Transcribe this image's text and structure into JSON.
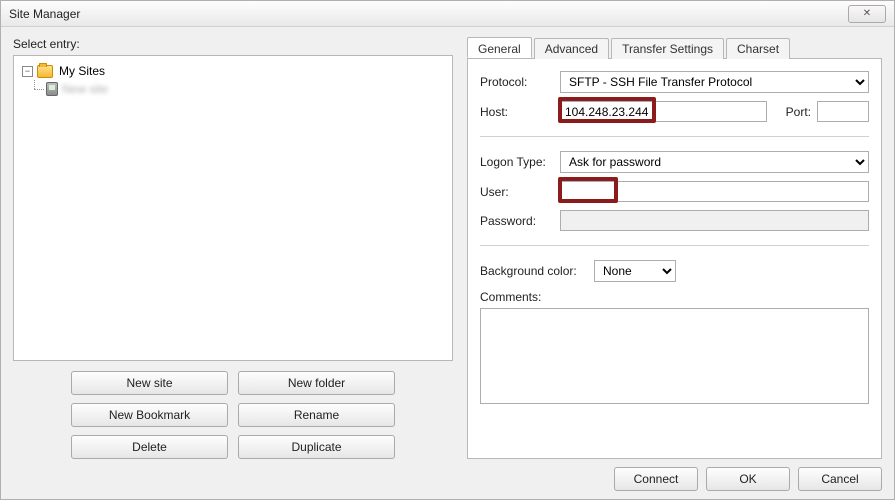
{
  "window": {
    "title": "Site Manager"
  },
  "left": {
    "select_entry": "Select entry:",
    "root": "My Sites",
    "child": "New site",
    "buttons": {
      "new_site": "New site",
      "new_folder": "New folder",
      "new_bookmark": "New Bookmark",
      "rename": "Rename",
      "delete": "Delete",
      "duplicate": "Duplicate"
    }
  },
  "tabs": {
    "general": "General",
    "advanced": "Advanced",
    "transfer": "Transfer Settings",
    "charset": "Charset"
  },
  "general": {
    "protocol_label": "Protocol:",
    "protocol_value": "SFTP - SSH File Transfer Protocol",
    "host_label": "Host:",
    "host_value": "104.248.23.244",
    "port_label": "Port:",
    "port_value": "",
    "logon_type_label": "Logon Type:",
    "logon_type_value": "Ask for password",
    "user_label": "User:",
    "user_value": "",
    "password_label": "Password:",
    "password_value": "",
    "bg_color_label": "Background color:",
    "bg_color_value": "None",
    "comments_label": "Comments:",
    "comments_value": ""
  },
  "footer": {
    "connect": "Connect",
    "ok": "OK",
    "cancel": "Cancel"
  }
}
